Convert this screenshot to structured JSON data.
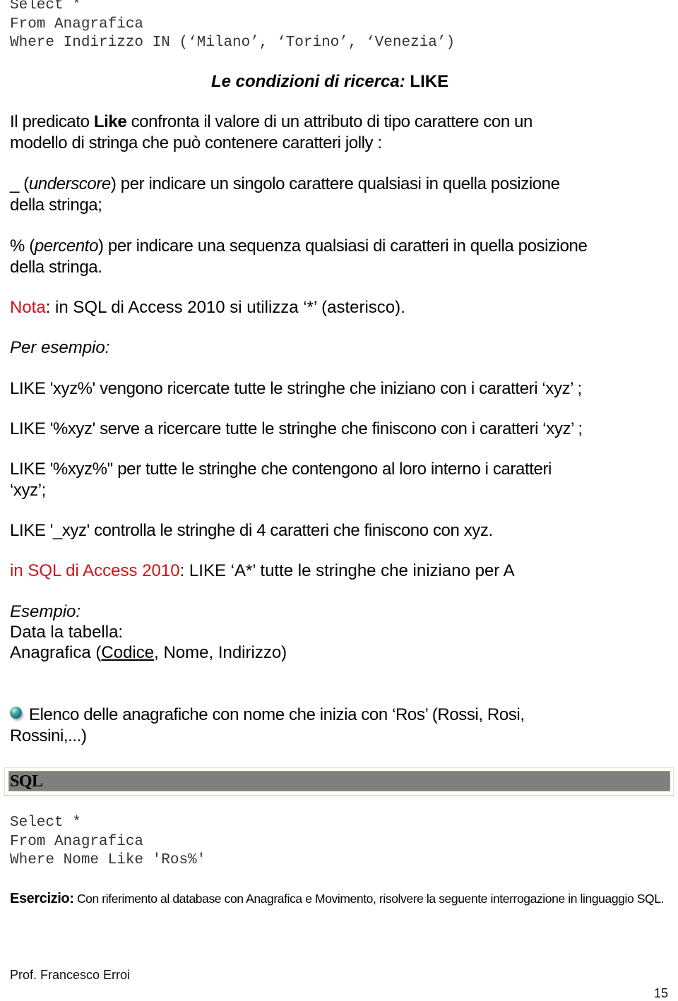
{
  "code_top": {
    "lines": [
      "Select *",
      "From Anagrafica",
      "Where Indirizzo IN (‘Milano’, ‘Torino’, ‘Venezia’)"
    ]
  },
  "section_title": {
    "italic_part": "Le condizioni di ricerca:",
    "bold_part": "LIKE"
  },
  "like_intro": {
    "before": "Il predicato ",
    "bold": "Like",
    "after_line1": " confronta il valore di un attributo di tipo carattere con un",
    "line2": "modello di stringa che può contenere caratteri jolly :"
  },
  "wildcards": [
    {
      "symbol": "_ (",
      "name": "underscore",
      "rest": ") per indicare un singolo carattere qualsiasi in quella posizione",
      "line2": "della stringa;"
    },
    {
      "symbol": "% (",
      "name": "percento",
      "rest": ") per indicare una sequenza qualsiasi di caratteri in quella posizione",
      "line2": "della stringa."
    }
  ],
  "nota": {
    "label": "Nota",
    "text": ": in SQL di Access 2010 si utilizza ‘*’ (asterisco)."
  },
  "per_esempio": "Per esempio:",
  "examples": [
    "LIKE 'xyz%' vengono ricercate tutte le stringhe che iniziano con i caratteri ‘xyz’ ;",
    "LIKE '%xyz' serve a ricercare tutte le stringhe che finiscono con i caratteri ‘xyz’ ;",
    "LIKE '%xyz%'' per tutte le stringhe che contengono al loro interno i caratteri",
    "‘xyz’;",
    "LIKE '_xyz' controlla le stringhe di 4 caratteri che finiscono con xyz."
  ],
  "access_note": {
    "label": "in SQL di Access 2010",
    "text": ": LIKE ‘A*’ tutte le stringhe che iniziano per A"
  },
  "esempio": {
    "heading": "Esempio:",
    "line2": "Data la tabella:",
    "table_name": "Anagrafica (",
    "key_field": "Codice",
    "other_fields": ", Nome, Indirizzo)"
  },
  "elenco": {
    "bullet_icon": "teal-sphere-bullet",
    "line1": "Elenco delle anagrafiche con nome che inizia con ‘Ros’ (Rossi, Rosi,",
    "line2": "Rossini,...)"
  },
  "sql_bar": {
    "label": "SQL"
  },
  "code_bottom": {
    "lines": [
      "Select *",
      "From Anagrafica",
      "Where Nome Like 'Ros%'"
    ]
  },
  "esercizio": {
    "label": "Esercizio:",
    "text": " Con riferimento al database con Anagrafica e Movimento, risolvere la seguente interrogazione in linguaggio SQL."
  },
  "footer": {
    "author": "Prof. Francesco Erroi",
    "page_number": "15"
  },
  "colors": {
    "accent_red": "#d0121b",
    "code_text": "#333333",
    "sql_bar_bg": "#7f7f7f"
  }
}
